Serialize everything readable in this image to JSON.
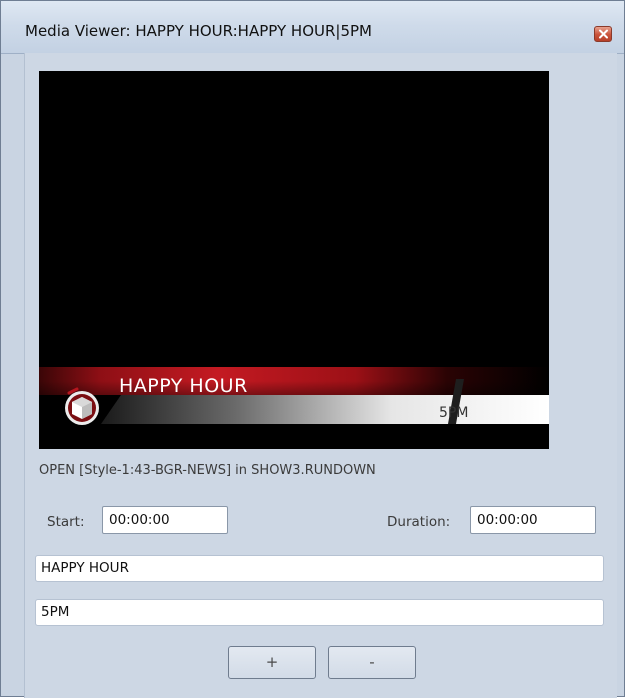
{
  "window": {
    "title": "Media Viewer: HAPPY HOUR:HAPPY HOUR|5PM"
  },
  "preview": {
    "overlay_title": "HAPPY HOUR",
    "overlay_time": "5PM"
  },
  "status_line": "OPEN [Style-1:43-BGR-NEWS] in SHOW3.RUNDOWN",
  "timing": {
    "start_label": "Start:",
    "start_value": "00:00:00",
    "duration_label": "Duration:",
    "duration_value": "00:00:00"
  },
  "fields": {
    "line1": "HAPPY HOUR",
    "line2": "5PM"
  },
  "buttons": {
    "add": "+",
    "remove": "-"
  },
  "icons": {
    "close": "close-icon",
    "logo": "station-logo-icon"
  },
  "colors": {
    "window_bg": "#c9d4e2",
    "accent_red": "#b5161e",
    "close_red": "#c9523a"
  }
}
